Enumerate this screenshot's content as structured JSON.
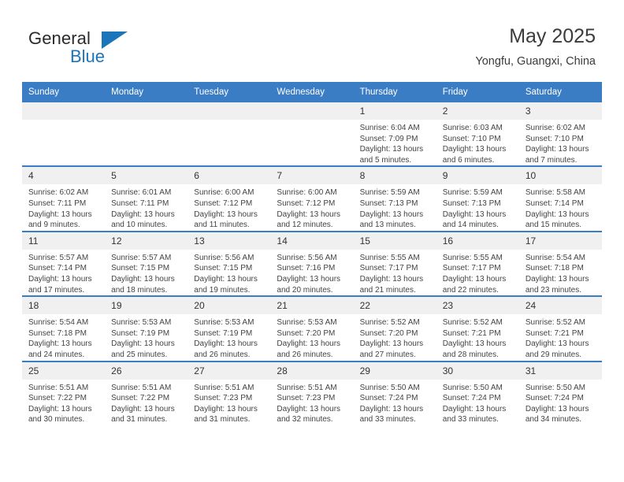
{
  "brand": {
    "name_part1": "General",
    "name_part2": "Blue",
    "triangle_icon": "blue-triangle-icon",
    "accent_color": "#1b75bb"
  },
  "header": {
    "title": "May 2025",
    "subtitle": "Yongfu, Guangxi, China"
  },
  "theme": {
    "header_blue": "#3b7dc4",
    "daynum_band": "#f0f0f0",
    "text": "#434343"
  },
  "calendar": {
    "weekday_headers": [
      "Sunday",
      "Monday",
      "Tuesday",
      "Wednesday",
      "Thursday",
      "Friday",
      "Saturday"
    ],
    "weeks": [
      [
        {
          "day": "",
          "empty": true
        },
        {
          "day": "",
          "empty": true
        },
        {
          "day": "",
          "empty": true
        },
        {
          "day": "",
          "empty": true
        },
        {
          "day": "1",
          "sunrise": "Sunrise: 6:04 AM",
          "sunset": "Sunset: 7:09 PM",
          "daylight": "Daylight: 13 hours and 5 minutes."
        },
        {
          "day": "2",
          "sunrise": "Sunrise: 6:03 AM",
          "sunset": "Sunset: 7:10 PM",
          "daylight": "Daylight: 13 hours and 6 minutes."
        },
        {
          "day": "3",
          "sunrise": "Sunrise: 6:02 AM",
          "sunset": "Sunset: 7:10 PM",
          "daylight": "Daylight: 13 hours and 7 minutes."
        }
      ],
      [
        {
          "day": "4",
          "sunrise": "Sunrise: 6:02 AM",
          "sunset": "Sunset: 7:11 PM",
          "daylight": "Daylight: 13 hours and 9 minutes."
        },
        {
          "day": "5",
          "sunrise": "Sunrise: 6:01 AM",
          "sunset": "Sunset: 7:11 PM",
          "daylight": "Daylight: 13 hours and 10 minutes."
        },
        {
          "day": "6",
          "sunrise": "Sunrise: 6:00 AM",
          "sunset": "Sunset: 7:12 PM",
          "daylight": "Daylight: 13 hours and 11 minutes."
        },
        {
          "day": "7",
          "sunrise": "Sunrise: 6:00 AM",
          "sunset": "Sunset: 7:12 PM",
          "daylight": "Daylight: 13 hours and 12 minutes."
        },
        {
          "day": "8",
          "sunrise": "Sunrise: 5:59 AM",
          "sunset": "Sunset: 7:13 PM",
          "daylight": "Daylight: 13 hours and 13 minutes."
        },
        {
          "day": "9",
          "sunrise": "Sunrise: 5:59 AM",
          "sunset": "Sunset: 7:13 PM",
          "daylight": "Daylight: 13 hours and 14 minutes."
        },
        {
          "day": "10",
          "sunrise": "Sunrise: 5:58 AM",
          "sunset": "Sunset: 7:14 PM",
          "daylight": "Daylight: 13 hours and 15 minutes."
        }
      ],
      [
        {
          "day": "11",
          "sunrise": "Sunrise: 5:57 AM",
          "sunset": "Sunset: 7:14 PM",
          "daylight": "Daylight: 13 hours and 17 minutes."
        },
        {
          "day": "12",
          "sunrise": "Sunrise: 5:57 AM",
          "sunset": "Sunset: 7:15 PM",
          "daylight": "Daylight: 13 hours and 18 minutes."
        },
        {
          "day": "13",
          "sunrise": "Sunrise: 5:56 AM",
          "sunset": "Sunset: 7:15 PM",
          "daylight": "Daylight: 13 hours and 19 minutes."
        },
        {
          "day": "14",
          "sunrise": "Sunrise: 5:56 AM",
          "sunset": "Sunset: 7:16 PM",
          "daylight": "Daylight: 13 hours and 20 minutes."
        },
        {
          "day": "15",
          "sunrise": "Sunrise: 5:55 AM",
          "sunset": "Sunset: 7:17 PM",
          "daylight": "Daylight: 13 hours and 21 minutes."
        },
        {
          "day": "16",
          "sunrise": "Sunrise: 5:55 AM",
          "sunset": "Sunset: 7:17 PM",
          "daylight": "Daylight: 13 hours and 22 minutes."
        },
        {
          "day": "17",
          "sunrise": "Sunrise: 5:54 AM",
          "sunset": "Sunset: 7:18 PM",
          "daylight": "Daylight: 13 hours and 23 minutes."
        }
      ],
      [
        {
          "day": "18",
          "sunrise": "Sunrise: 5:54 AM",
          "sunset": "Sunset: 7:18 PM",
          "daylight": "Daylight: 13 hours and 24 minutes."
        },
        {
          "day": "19",
          "sunrise": "Sunrise: 5:53 AM",
          "sunset": "Sunset: 7:19 PM",
          "daylight": "Daylight: 13 hours and 25 minutes."
        },
        {
          "day": "20",
          "sunrise": "Sunrise: 5:53 AM",
          "sunset": "Sunset: 7:19 PM",
          "daylight": "Daylight: 13 hours and 26 minutes."
        },
        {
          "day": "21",
          "sunrise": "Sunrise: 5:53 AM",
          "sunset": "Sunset: 7:20 PM",
          "daylight": "Daylight: 13 hours and 26 minutes."
        },
        {
          "day": "22",
          "sunrise": "Sunrise: 5:52 AM",
          "sunset": "Sunset: 7:20 PM",
          "daylight": "Daylight: 13 hours and 27 minutes."
        },
        {
          "day": "23",
          "sunrise": "Sunrise: 5:52 AM",
          "sunset": "Sunset: 7:21 PM",
          "daylight": "Daylight: 13 hours and 28 minutes."
        },
        {
          "day": "24",
          "sunrise": "Sunrise: 5:52 AM",
          "sunset": "Sunset: 7:21 PM",
          "daylight": "Daylight: 13 hours and 29 minutes."
        }
      ],
      [
        {
          "day": "25",
          "sunrise": "Sunrise: 5:51 AM",
          "sunset": "Sunset: 7:22 PM",
          "daylight": "Daylight: 13 hours and 30 minutes."
        },
        {
          "day": "26",
          "sunrise": "Sunrise: 5:51 AM",
          "sunset": "Sunset: 7:22 PM",
          "daylight": "Daylight: 13 hours and 31 minutes."
        },
        {
          "day": "27",
          "sunrise": "Sunrise: 5:51 AM",
          "sunset": "Sunset: 7:23 PM",
          "daylight": "Daylight: 13 hours and 31 minutes."
        },
        {
          "day": "28",
          "sunrise": "Sunrise: 5:51 AM",
          "sunset": "Sunset: 7:23 PM",
          "daylight": "Daylight: 13 hours and 32 minutes."
        },
        {
          "day": "29",
          "sunrise": "Sunrise: 5:50 AM",
          "sunset": "Sunset: 7:24 PM",
          "daylight": "Daylight: 13 hours and 33 minutes."
        },
        {
          "day": "30",
          "sunrise": "Sunrise: 5:50 AM",
          "sunset": "Sunset: 7:24 PM",
          "daylight": "Daylight: 13 hours and 33 minutes."
        },
        {
          "day": "31",
          "sunrise": "Sunrise: 5:50 AM",
          "sunset": "Sunset: 7:24 PM",
          "daylight": "Daylight: 13 hours and 34 minutes."
        }
      ]
    ]
  }
}
